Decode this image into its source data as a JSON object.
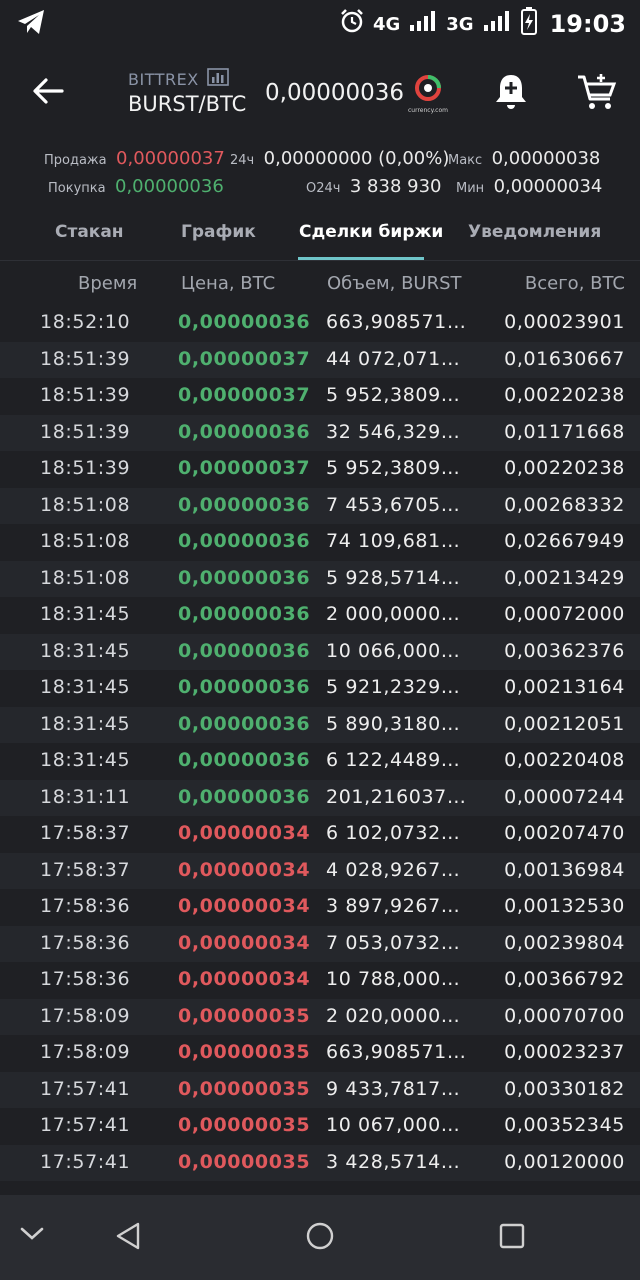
{
  "status": {
    "network1": "4G",
    "network2": "3G",
    "time": "19:03"
  },
  "header": {
    "exchange": "BITTREX",
    "pair": "BURST/BTC",
    "last_price": "0,00000036",
    "logo_text": "currency.com"
  },
  "stats": {
    "sell_label": "Продажа",
    "sell_value": "0,00000037",
    "buy_label": "Покупка",
    "buy_value": "0,00000036",
    "change_label": "24ч",
    "change_value": "0,00000000 (0,00%)",
    "volume_label": "О24ч",
    "volume_value": "3 838 930",
    "max_label": "Макс",
    "max_value": "0,00000038",
    "min_label": "Мин",
    "min_value": "0,00000034"
  },
  "tabs": [
    {
      "label": "Стакан"
    },
    {
      "label": "График"
    },
    {
      "label": "Сделки биржи"
    },
    {
      "label": "Уведомления"
    }
  ],
  "table": {
    "headers": [
      "Время",
      "Цена, BTC",
      "Объем, BURST",
      "Всего, BTC"
    ],
    "rows": [
      {
        "time": "18:52:10",
        "price": "0,00000036",
        "side": "green",
        "volume": "663,908571…",
        "total": "0,00023901"
      },
      {
        "time": "18:51:39",
        "price": "0,00000037",
        "side": "green",
        "volume": "44 072,071…",
        "total": "0,01630667"
      },
      {
        "time": "18:51:39",
        "price": "0,00000037",
        "side": "green",
        "volume": "5 952,3809…",
        "total": "0,00220238"
      },
      {
        "time": "18:51:39",
        "price": "0,00000036",
        "side": "green",
        "volume": "32 546,329…",
        "total": "0,01171668"
      },
      {
        "time": "18:51:39",
        "price": "0,00000037",
        "side": "green",
        "volume": "5 952,3809…",
        "total": "0,00220238"
      },
      {
        "time": "18:51:08",
        "price": "0,00000036",
        "side": "green",
        "volume": "7 453,6705…",
        "total": "0,00268332"
      },
      {
        "time": "18:51:08",
        "price": "0,00000036",
        "side": "green",
        "volume": "74 109,681…",
        "total": "0,02667949"
      },
      {
        "time": "18:51:08",
        "price": "0,00000036",
        "side": "green",
        "volume": "5 928,5714…",
        "total": "0,00213429"
      },
      {
        "time": "18:31:45",
        "price": "0,00000036",
        "side": "green",
        "volume": "2 000,0000…",
        "total": "0,00072000"
      },
      {
        "time": "18:31:45",
        "price": "0,00000036",
        "side": "green",
        "volume": "10 066,000…",
        "total": "0,00362376"
      },
      {
        "time": "18:31:45",
        "price": "0,00000036",
        "side": "green",
        "volume": "5 921,2329…",
        "total": "0,00213164"
      },
      {
        "time": "18:31:45",
        "price": "0,00000036",
        "side": "green",
        "volume": "5 890,3180…",
        "total": "0,00212051"
      },
      {
        "time": "18:31:45",
        "price": "0,00000036",
        "side": "green",
        "volume": "6 122,4489…",
        "total": "0,00220408"
      },
      {
        "time": "18:31:11",
        "price": "0,00000036",
        "side": "green",
        "volume": "201,216037…",
        "total": "0,00007244"
      },
      {
        "time": "17:58:37",
        "price": "0,00000034",
        "side": "red",
        "volume": "6 102,0732…",
        "total": "0,00207470"
      },
      {
        "time": "17:58:37",
        "price": "0,00000034",
        "side": "red",
        "volume": "4 028,9267…",
        "total": "0,00136984"
      },
      {
        "time": "17:58:36",
        "price": "0,00000034",
        "side": "red",
        "volume": "3 897,9267…",
        "total": "0,00132530"
      },
      {
        "time": "17:58:36",
        "price": "0,00000034",
        "side": "red",
        "volume": "7 053,0732…",
        "total": "0,00239804"
      },
      {
        "time": "17:58:36",
        "price": "0,00000034",
        "side": "red",
        "volume": "10 788,000…",
        "total": "0,00366792"
      },
      {
        "time": "17:58:09",
        "price": "0,00000035",
        "side": "red",
        "volume": "2 020,0000…",
        "total": "0,00070700"
      },
      {
        "time": "17:58:09",
        "price": "0,00000035",
        "side": "red",
        "volume": "663,908571…",
        "total": "0,00023237"
      },
      {
        "time": "17:57:41",
        "price": "0,00000035",
        "side": "red",
        "volume": "9 433,7817…",
        "total": "0,00330182"
      },
      {
        "time": "17:57:41",
        "price": "0,00000035",
        "side": "red",
        "volume": "10 067,000…",
        "total": "0,00352345"
      },
      {
        "time": "17:57:41",
        "price": "0,00000035",
        "side": "red",
        "volume": "3 428,5714…",
        "total": "0,00120000"
      }
    ]
  },
  "colors": {
    "background": "#1f2024",
    "buy_green": "#4fb06f",
    "sell_red": "#e0595d",
    "tab_indicator": "#6fc5c9"
  }
}
